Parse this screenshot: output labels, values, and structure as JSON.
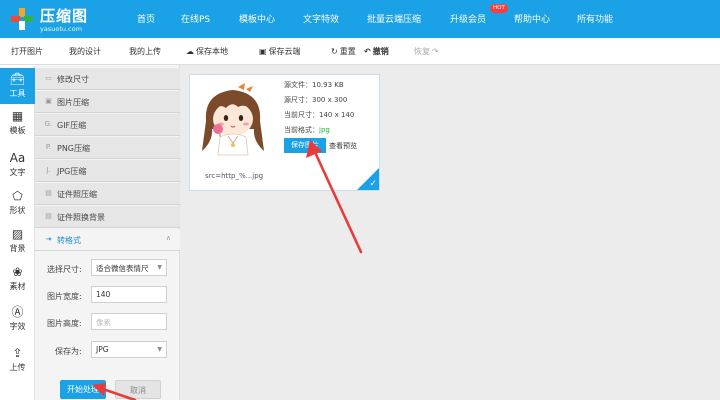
{
  "brand": {
    "title": "压缩图",
    "subtitle": "yasuotu.com",
    "colors": {
      "primary": "#1aa1e6",
      "hot": "#ff3b3b",
      "arrow": "#e83b3b"
    }
  },
  "nav": {
    "items": [
      "首页",
      "在线PS",
      "模板中心",
      "文字特效",
      "批量云端压缩",
      "升级会员",
      "帮助中心",
      "所有功能"
    ],
    "hot_badge": "HOT"
  },
  "toolbar": {
    "open_image": "打开图片",
    "my_designs": "我的设计",
    "my_uploads": "我的上传",
    "save_local": "保存本地",
    "save_cloud": "保存云端",
    "reset": "重置",
    "undo": "撤销",
    "redo": "恢复"
  },
  "rail": {
    "items": [
      {
        "label": "工具",
        "icon": "toolbox-icon",
        "active": true
      },
      {
        "label": "模板",
        "icon": "template-icon",
        "active": false
      },
      {
        "label": "文字",
        "icon": "text-icon",
        "active": false
      },
      {
        "label": "形状",
        "icon": "shape-icon",
        "active": false
      },
      {
        "label": "背景",
        "icon": "background-icon",
        "active": false
      },
      {
        "label": "素材",
        "icon": "material-icon",
        "active": false
      },
      {
        "label": "字效",
        "icon": "text-effect-icon",
        "active": false
      },
      {
        "label": "上传",
        "icon": "upload-icon",
        "active": false
      }
    ]
  },
  "panel": {
    "sections": [
      {
        "label": "修改尺寸",
        "icon": "resize-icon"
      },
      {
        "label": "图片压缩",
        "icon": "image-compress-icon"
      },
      {
        "label": "GIF压缩",
        "icon": "gif-icon"
      },
      {
        "label": "PNG压缩",
        "icon": "png-icon"
      },
      {
        "label": "JPG压缩",
        "icon": "jpg-icon"
      },
      {
        "label": "证件照压缩",
        "icon": "id-photo-icon"
      },
      {
        "label": "证件照换背景",
        "icon": "id-background-icon"
      },
      {
        "label": "转格式",
        "icon": "convert-icon"
      }
    ],
    "form": {
      "size_label": "选择尺寸:",
      "size_value": "适合微信表情尺",
      "width_label": "图片宽度:",
      "width_value": "140",
      "height_label": "图片高度:",
      "height_placeholder": "像素",
      "save_as_label": "保存为:",
      "save_as_value": "JPG"
    },
    "start_button": "开始处理",
    "cancel_button": "取消"
  },
  "card": {
    "original_file": "源文件：10.93 KB",
    "original_size": "源尺寸：300 x 300",
    "current_size": "当前尺寸：140 x 140",
    "current_format_label": "当前格式：",
    "current_format_value": "jpg",
    "save_button": "保存图片",
    "preview_link": "查看预览",
    "src": "src=http_%...jpg"
  }
}
